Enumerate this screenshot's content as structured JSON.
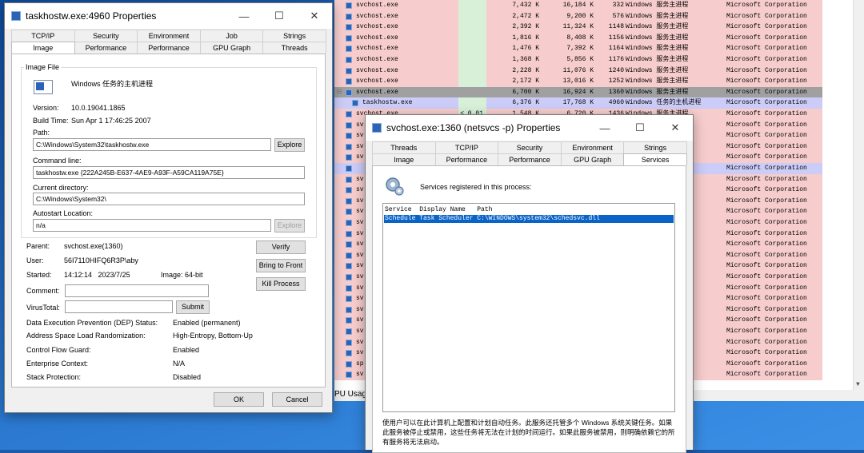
{
  "bg_window": {
    "rows": [
      {
        "name": "svchost.exe",
        "cpu": "",
        "ws": "7,432 K",
        "pb": "16,184 K",
        "pid": "332",
        "desc": "Windows 服务主进程",
        "company": "Microsoft Corporation",
        "style": "pink"
      },
      {
        "name": "svchost.exe",
        "cpu": "",
        "ws": "2,472 K",
        "pb": "9,200 K",
        "pid": "576",
        "desc": "Windows 服务主进程",
        "company": "Microsoft Corporation",
        "style": "pink"
      },
      {
        "name": "svchost.exe",
        "cpu": "",
        "ws": "2,392 K",
        "pb": "11,324 K",
        "pid": "1148",
        "desc": "Windows 服务主进程",
        "company": "Microsoft Corporation",
        "style": "pink"
      },
      {
        "name": "svchost.exe",
        "cpu": "",
        "ws": "1,816 K",
        "pb": "8,408 K",
        "pid": "1156",
        "desc": "Windows 服务主进程",
        "company": "Microsoft Corporation",
        "style": "pink"
      },
      {
        "name": "svchost.exe",
        "cpu": "",
        "ws": "1,476 K",
        "pb": "7,392 K",
        "pid": "1164",
        "desc": "Windows 服务主进程",
        "company": "Microsoft Corporation",
        "style": "pink"
      },
      {
        "name": "svchost.exe",
        "cpu": "",
        "ws": "1,368 K",
        "pb": "5,856 K",
        "pid": "1176",
        "desc": "Windows 服务主进程",
        "company": "Microsoft Corporation",
        "style": "pink"
      },
      {
        "name": "svchost.exe",
        "cpu": "",
        "ws": "2,228 K",
        "pb": "11,076 K",
        "pid": "1240",
        "desc": "Windows 服务主进程",
        "company": "Microsoft Corporation",
        "style": "pink"
      },
      {
        "name": "svchost.exe",
        "cpu": "",
        "ws": "2,172 K",
        "pb": "13,016 K",
        "pid": "1252",
        "desc": "Windows 服务主进程",
        "company": "Microsoft Corporation",
        "style": "pink"
      },
      {
        "name": "svchost.exe",
        "cpu": "",
        "ws": "6,700 K",
        "pb": "16,924 K",
        "pid": "1360",
        "desc": "Windows 服务主进程",
        "company": "Microsoft Corporation",
        "style": "sel"
      },
      {
        "name": "taskhostw.exe",
        "cpu": "",
        "ws": "6,376 K",
        "pb": "17,768 K",
        "pid": "4960",
        "desc": "Windows 任务的主机进程",
        "company": "Microsoft Corporation",
        "style": "lav"
      },
      {
        "name": "svchost.exe",
        "cpu": "< 0.01",
        "ws": "1,548 K",
        "pb": "6,720 K",
        "pid": "1436",
        "desc": "Windows 服务主进程",
        "company": "Microsoft Corporation",
        "style": "pink"
      },
      {
        "name": "sv",
        "cpu": "",
        "ws": "",
        "pb": "",
        "pid": "",
        "desc": "",
        "company": "Microsoft Corporation",
        "style": "pink"
      },
      {
        "name": "sv",
        "cpu": "",
        "ws": "",
        "pb": "",
        "pid": "",
        "desc": "",
        "company": "Microsoft Corporation",
        "style": "pink"
      },
      {
        "name": "sv",
        "cpu": "",
        "ws": "",
        "pb": "",
        "pid": "",
        "desc": "",
        "company": "Microsoft Corporation",
        "style": "pink"
      },
      {
        "name": "sv",
        "cpu": "",
        "ws": "",
        "pb": "",
        "pid": "",
        "desc": "",
        "company": "Microsoft Corporation",
        "style": "pink"
      },
      {
        "name": "",
        "cpu": "",
        "ws": "",
        "pb": "",
        "pid": "",
        "desc": "re Host",
        "company": "Microsoft Corporation",
        "style": "lav"
      },
      {
        "name": "sv",
        "cpu": "",
        "ws": "",
        "pb": "",
        "pid": "",
        "desc": "",
        "company": "Microsoft Corporation",
        "style": "pink"
      },
      {
        "name": "sv",
        "cpu": "",
        "ws": "",
        "pb": "",
        "pid": "",
        "desc": "",
        "company": "Microsoft Corporation",
        "style": "pink"
      },
      {
        "name": "sv",
        "cpu": "",
        "ws": "",
        "pb": "",
        "pid": "",
        "desc": "",
        "company": "Microsoft Corporation",
        "style": "pink"
      },
      {
        "name": "sv",
        "cpu": "",
        "ws": "",
        "pb": "",
        "pid": "",
        "desc": "",
        "company": "Microsoft Corporation",
        "style": "pink"
      },
      {
        "name": "sv",
        "cpu": "",
        "ws": "",
        "pb": "",
        "pid": "",
        "desc": "",
        "company": "Microsoft Corporation",
        "style": "pink"
      },
      {
        "name": "sv",
        "cpu": "",
        "ws": "",
        "pb": "",
        "pid": "",
        "desc": "",
        "company": "Microsoft Corporation",
        "style": "pink"
      },
      {
        "name": "sv",
        "cpu": "",
        "ws": "",
        "pb": "",
        "pid": "",
        "desc": "",
        "company": "Microsoft Corporation",
        "style": "pink"
      },
      {
        "name": "sv",
        "cpu": "",
        "ws": "",
        "pb": "",
        "pid": "",
        "desc": "",
        "company": "Microsoft Corporation",
        "style": "pink"
      },
      {
        "name": "sv",
        "cpu": "",
        "ws": "",
        "pb": "",
        "pid": "",
        "desc": "",
        "company": "Microsoft Corporation",
        "style": "pink"
      },
      {
        "name": "sv",
        "cpu": "",
        "ws": "",
        "pb": "",
        "pid": "",
        "desc": "",
        "company": "Microsoft Corporation",
        "style": "pink"
      },
      {
        "name": "sv",
        "cpu": "",
        "ws": "",
        "pb": "",
        "pid": "",
        "desc": "",
        "company": "Microsoft Corporation",
        "style": "pink"
      },
      {
        "name": "sv",
        "cpu": "",
        "ws": "",
        "pb": "",
        "pid": "",
        "desc": "",
        "company": "Microsoft Corporation",
        "style": "pink"
      },
      {
        "name": "sv",
        "cpu": "",
        "ws": "",
        "pb": "",
        "pid": "",
        "desc": "",
        "company": "Microsoft Corporation",
        "style": "pink"
      },
      {
        "name": "sv",
        "cpu": "",
        "ws": "",
        "pb": "",
        "pid": "",
        "desc": "",
        "company": "Microsoft Corporation",
        "style": "pink"
      },
      {
        "name": "sv",
        "cpu": "",
        "ws": "",
        "pb": "",
        "pid": "",
        "desc": "",
        "company": "Microsoft Corporation",
        "style": "pink"
      },
      {
        "name": "sv",
        "cpu": "",
        "ws": "",
        "pb": "",
        "pid": "",
        "desc": "",
        "company": "Microsoft Corporation",
        "style": "pink"
      },
      {
        "name": "sv",
        "cpu": "",
        "ws": "",
        "pb": "",
        "pid": "",
        "desc": "",
        "company": "Microsoft Corporation",
        "style": "pink"
      },
      {
        "name": "sp",
        "cpu": "",
        "ws": "",
        "pb": "",
        "pid": "",
        "desc": "用",
        "company": "Microsoft Corporation",
        "style": "pink"
      },
      {
        "name": "sv",
        "cpu": "",
        "ws": "",
        "pb": "",
        "pid": "",
        "desc": "",
        "company": "Microsoft Corporation",
        "style": "pink"
      }
    ],
    "footer": "PU Usage"
  },
  "taskhost": {
    "title": "taskhostw.exe:4960 Properties",
    "tabs_row1": [
      "TCP/IP",
      "Security",
      "Environment",
      "Job",
      "Strings"
    ],
    "tabs_row2": [
      "Image",
      "Performance",
      "Performance Graph",
      "GPU Graph",
      "Threads"
    ],
    "group_label": "Image File",
    "file_desc": "Windows 任务的主机进程",
    "version_label": "Version:",
    "version": "10.0.19041.1865",
    "build_label": "Build Time:",
    "build": "Sun Apr  1 17:46:25 2007",
    "path_label": "Path:",
    "path": "C:\\Windows\\System32\\taskhostw.exe",
    "explore": "Explore",
    "cmd_label": "Command line:",
    "cmd": "taskhostw.exe {222A245B-E637-4AE9-A93F-A59CA119A75E}",
    "curdir_label": "Current directory:",
    "curdir": "C:\\Windows\\System32\\",
    "autostart_label": "Autostart Location:",
    "autostart": "n/a",
    "parent_label": "Parent:",
    "parent": "svchost.exe(1360)",
    "user_label": "User:",
    "user": "56I7110HIFQ6R3P\\aby",
    "started_label": "Started:",
    "started": "14:12:14   2023/7/25",
    "image_bits": "Image: 64-bit",
    "verify": "Verify",
    "bring_front": "Bring to Front",
    "kill": "Kill Process",
    "comment_label": "Comment:",
    "virustotal_label": "VirusTotal:",
    "submit": "Submit",
    "dep_label": "Data Execution Prevention (DEP) Status:",
    "dep": "Enabled (permanent)",
    "aslr_label": "Address Space Load Randomization:",
    "aslr": "High-Entropy, Bottom-Up",
    "cfg_label": "Control Flow Guard:",
    "cfg": "Enabled",
    "ent_label": "Enterprise Context:",
    "ent": "N/A",
    "stack_label": "Stack Protection:",
    "stack": "Disabled",
    "ok": "OK",
    "cancel": "Cancel"
  },
  "svchost": {
    "title": "svchost.exe:1360 (netsvcs -p) Properties",
    "tabs_row1": [
      "Threads",
      "TCP/IP",
      "Security",
      "Environment",
      "Strings"
    ],
    "tabs_row2": [
      "Image",
      "Performance",
      "Performance Graph",
      "GPU Graph",
      "Services"
    ],
    "registered": "Services registered in this process:",
    "list_header": "Service  Display Name   Path",
    "list_row": "Schedule Task Scheduler C:\\WINDOWS\\system32\\schedsvc.dll",
    "description": "使用户可以在此计算机上配置和计划自动任务。此服务还托管多个 Windows 系统关键任务。如果此服务被停止或禁用，这些任务将无法在计划的时间运行。如果此服务被禁用，则明确依赖它的所有服务将无法启动。"
  },
  "colors": {
    "pink": "#f6cccc",
    "lav": "#ccccf8",
    "sel": "#a0a0a0",
    "accent": "#0a64c8"
  }
}
